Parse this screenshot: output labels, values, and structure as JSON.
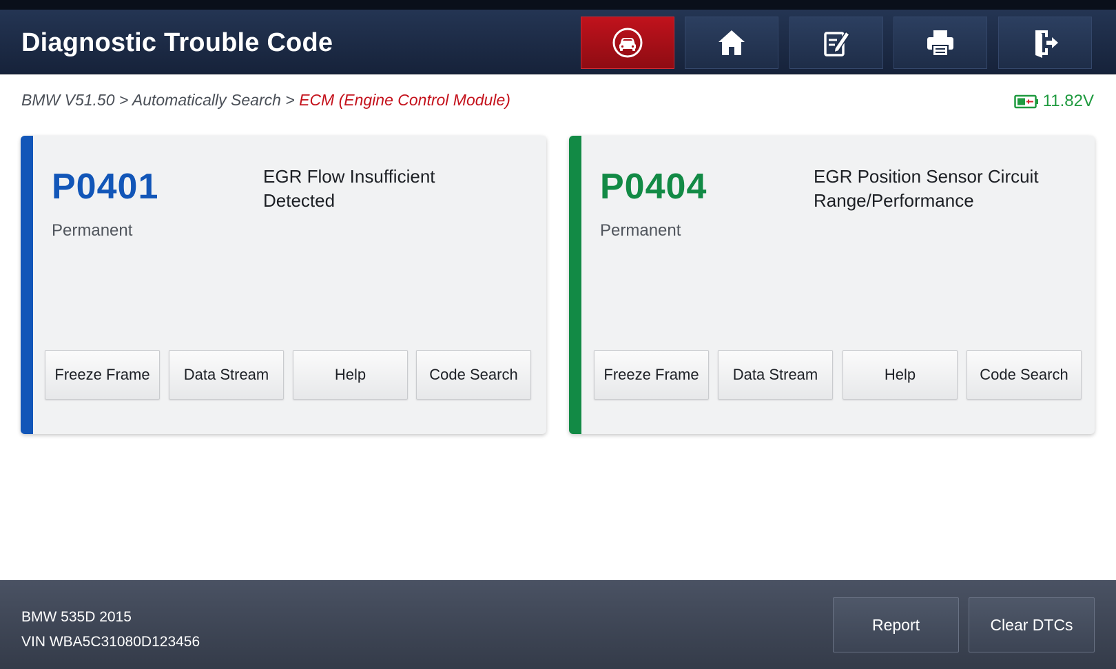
{
  "header": {
    "title": "Diagnostic Trouble Code",
    "buttons": [
      {
        "name": "vehicle-button",
        "icon": "car-icon",
        "active": true
      },
      {
        "name": "home-button",
        "icon": "home-icon",
        "active": false
      },
      {
        "name": "edit-button",
        "icon": "edit-icon",
        "active": false
      },
      {
        "name": "print-button",
        "icon": "print-icon",
        "active": false
      },
      {
        "name": "exit-button",
        "icon": "exit-icon",
        "active": false
      }
    ]
  },
  "breadcrumb": {
    "path": "BMW V51.50 > Automatically Search > ",
    "current": "ECM (Engine Control Module)"
  },
  "battery": {
    "icon": "battery-icon",
    "voltage": "11.82V",
    "color": "#1f9a3f"
  },
  "dtcs": [
    {
      "code": "P0401",
      "status": "Permanent",
      "description_line1": "EGR Flow Insufficient",
      "description_line2": "Detected",
      "accent_color": "#1256b8",
      "buttons": [
        "Freeze Frame",
        "Data Stream",
        "Help",
        "Code Search"
      ]
    },
    {
      "code": "P0404",
      "status": "Permanent",
      "description_line1": "EGR Position Sensor Circuit",
      "description_line2": "Range/Performance",
      "accent_color": "#128a45",
      "buttons": [
        "Freeze Frame",
        "Data Stream",
        "Help",
        "Code Search"
      ]
    }
  ],
  "footer": {
    "vehicle": "BMW 535D 2015",
    "vin": "VIN WBA5C31080D123456",
    "report_label": "Report",
    "clear_label": "Clear DTCs"
  }
}
